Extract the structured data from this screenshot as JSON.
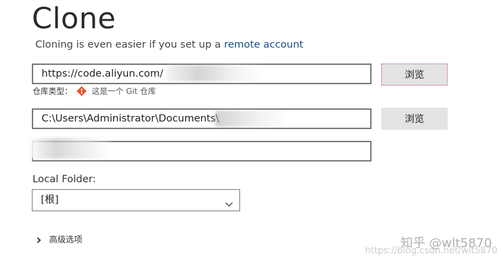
{
  "title": "Clone",
  "subtitle": {
    "text": "Cloning is even easier if you set up a ",
    "link": "remote account"
  },
  "source_url": {
    "value": "https://code.aliyun.com/"
  },
  "browse_label": "浏览",
  "repo_type": {
    "label": "仓库类型：",
    "value": "这是一个 Git 仓库",
    "icon": "git-icon",
    "icon_color": "#e8512d"
  },
  "destination_path": {
    "value": "C:\\Users\\Administrator\\Documents\\"
  },
  "name_field": {
    "value": ""
  },
  "local_folder": {
    "label": "Local Folder:",
    "selected": "[根]"
  },
  "advanced_options": "高级选项",
  "watermark": {
    "main": "知乎 @wlt5870",
    "sub": "https://blog.csdn.net/wlt5870"
  },
  "colors": {
    "link": "#1b4e85",
    "button_bg": "#e3e3e3",
    "border": "#7a7a7a"
  }
}
